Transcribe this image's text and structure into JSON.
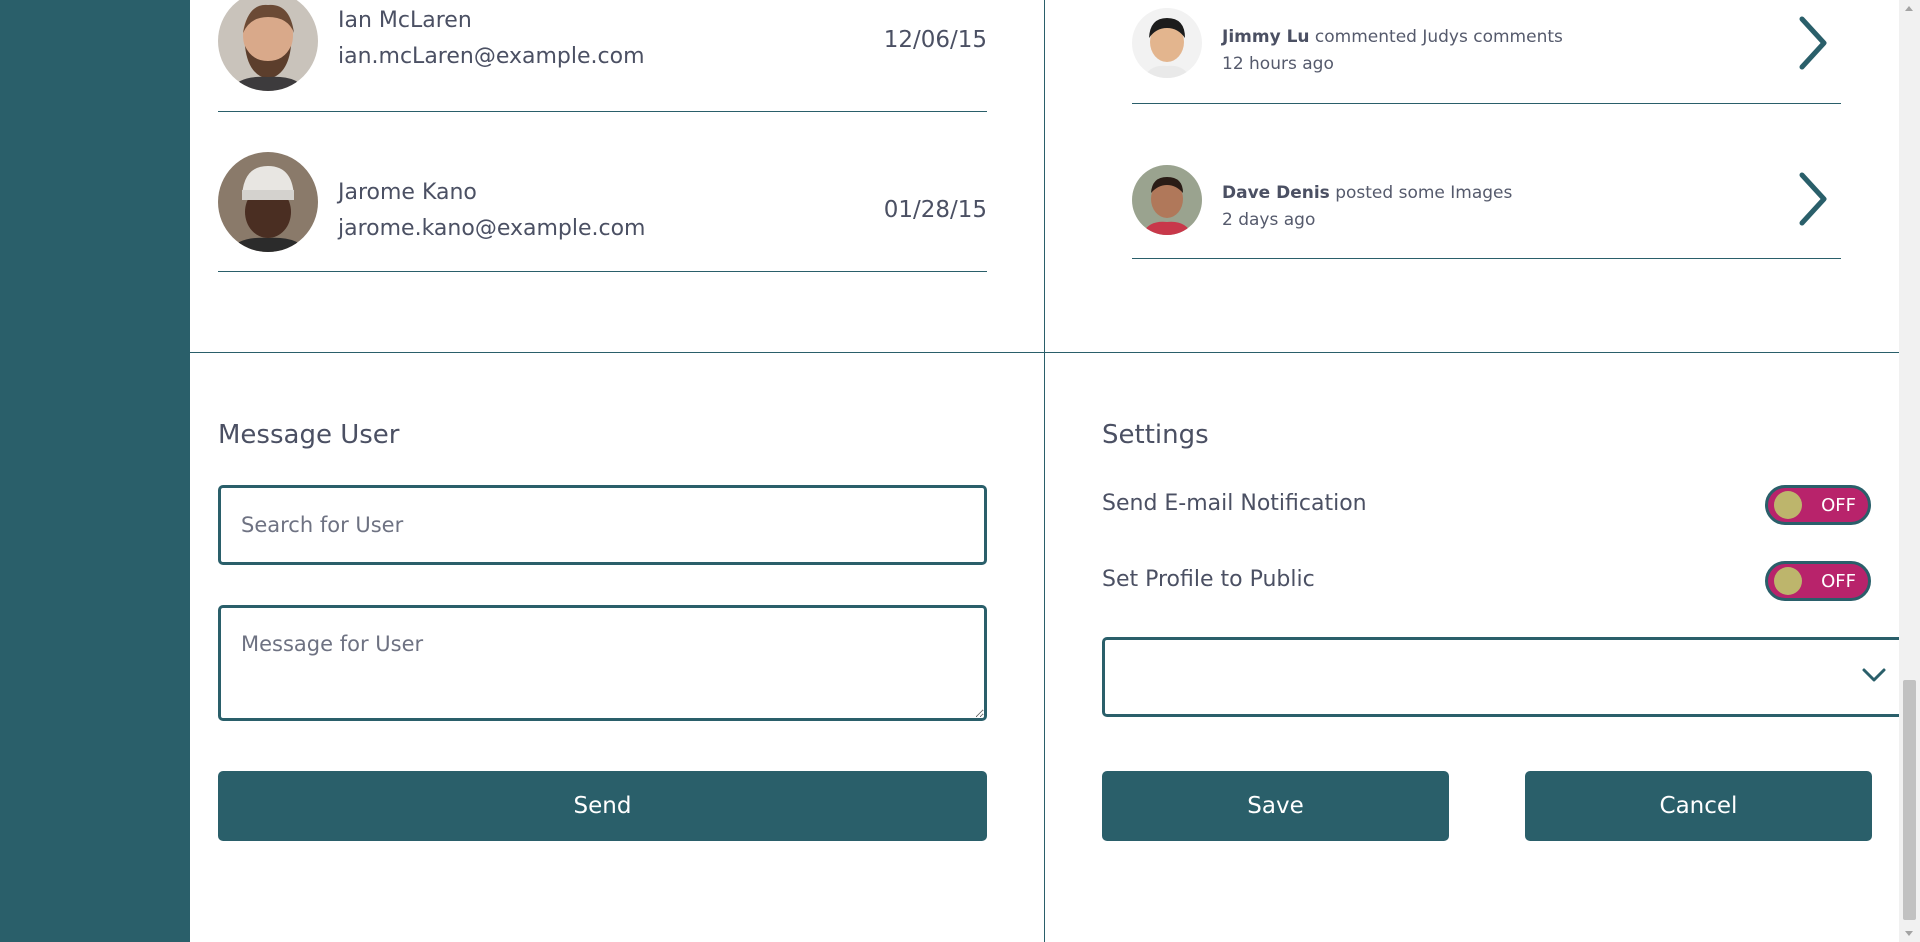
{
  "colors": {
    "primary": "#2a5f6a",
    "toggle_off_bg": "#b8236b",
    "toggle_knob": "#bdb56c",
    "text": "#4b5063"
  },
  "members": [
    {
      "name": "Ian McLaren",
      "email": "ian.mcLaren@example.com",
      "date": "12/06/15"
    },
    {
      "name": "Jarome Kano",
      "email": "jarome.kano@example.com",
      "date": "01/28/15"
    }
  ],
  "activity": [
    {
      "user": "Jimmy Lu",
      "action": "commented Judys comments",
      "time": "12 hours ago",
      "icon": "chevron-right-icon"
    },
    {
      "user": "Dave Denis",
      "action": "posted some Images",
      "time": "2 days ago",
      "icon": "chevron-right-icon"
    }
  ],
  "message": {
    "title": "Message User",
    "search_placeholder": "Search for User",
    "message_placeholder": "Message for User",
    "send_label": "Send"
  },
  "settings": {
    "title": "Settings",
    "email_notification_label": "Send E-mail Notification",
    "email_notification_state": "OFF",
    "public_profile_label": "Set Profile to Public",
    "public_profile_state": "OFF",
    "dropdown_value": "",
    "save_label": "Save",
    "cancel_label": "Cancel"
  }
}
